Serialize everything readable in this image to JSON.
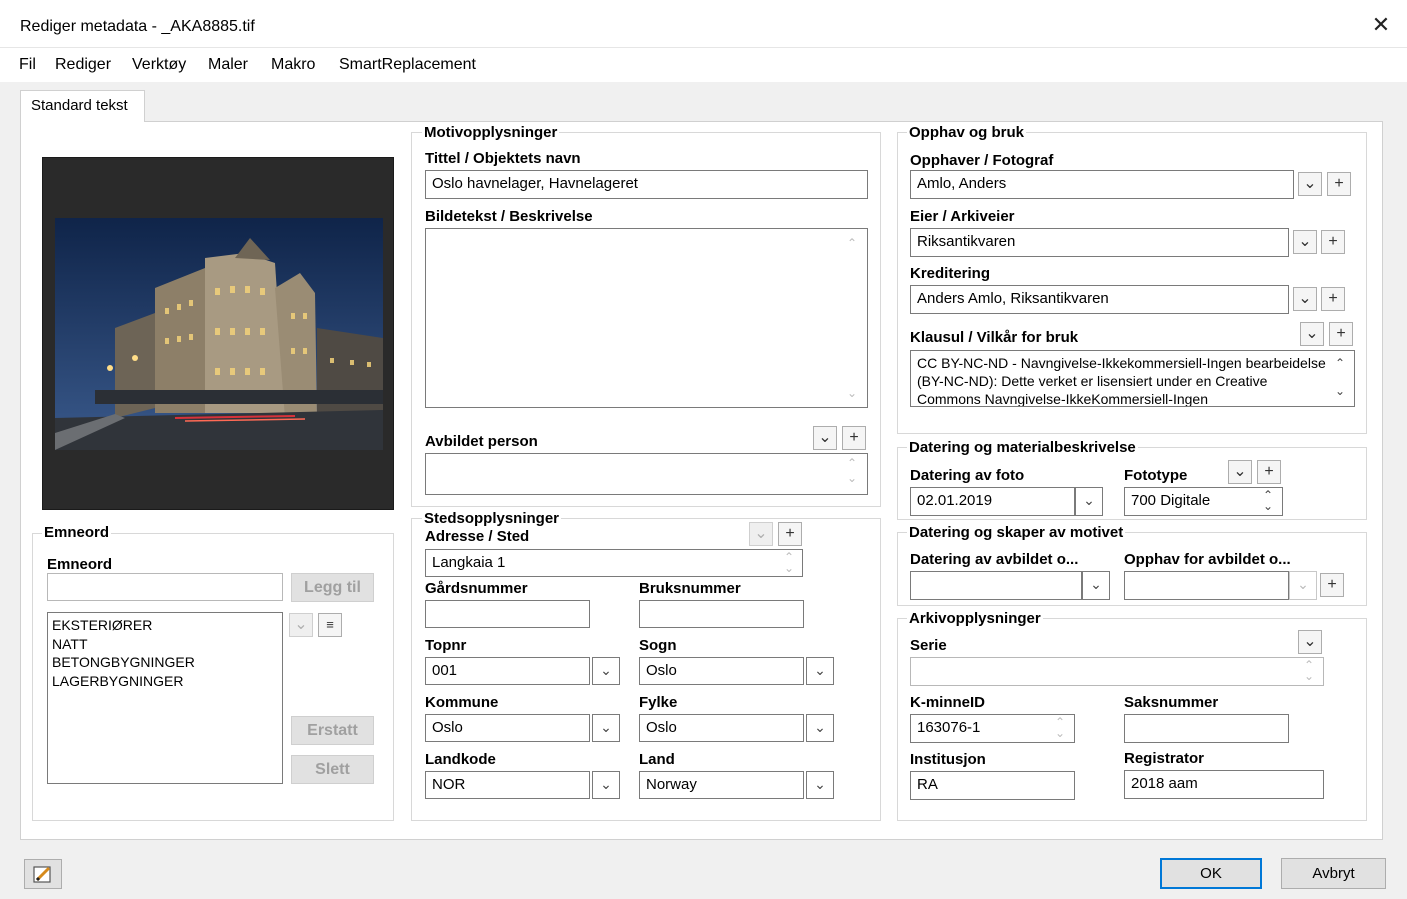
{
  "window": {
    "title": "Rediger metadata - _AKA8885.tif",
    "close": "✕"
  },
  "menu": [
    "Fil",
    "Rediger",
    "Verktøy",
    "Maler",
    "Makro",
    "SmartReplacement"
  ],
  "tab": "Standard tekst",
  "emneord": {
    "legend": "Emneord",
    "label": "Emneord",
    "input_value": "",
    "add_label": "Legg til",
    "items": [
      "EKSTERIØRER",
      "NATT",
      "BETONGBYGNINGER",
      "LAGERBYGNINGER"
    ],
    "replace_label": "Erstatt",
    "delete_label": "Slett"
  },
  "motiv": {
    "legend": "Motivopplysninger",
    "title_label": "Tittel / Objektets navn",
    "title_value": "Oslo havnelager, Havnelageret",
    "caption_label": "Bildetekst / Beskrivelse",
    "caption_value": "",
    "person_label": "Avbildet person",
    "person_value": ""
  },
  "sted": {
    "legend": "Stedsopplysninger",
    "address_label": "Adresse / Sted",
    "address_value": "Langkaia 1",
    "gardsnr_label": "Gårdsnummer",
    "gardsnr_value": "",
    "bruksnr_label": "Bruksnummer",
    "bruksnr_value": "",
    "topnr_label": "Topnr",
    "topnr_value": "001",
    "sogn_label": "Sogn",
    "sogn_value": "Oslo",
    "kommune_label": "Kommune",
    "kommune_value": "Oslo",
    "fylke_label": "Fylke",
    "fylke_value": "Oslo",
    "landkode_label": "Landkode",
    "landkode_value": "NOR",
    "land_label": "Land",
    "land_value": "Norway"
  },
  "opphav": {
    "legend": "Opphav og bruk",
    "photographer_label": "Opphaver / Fotograf",
    "photographer_value": "Amlo, Anders",
    "owner_label": "Eier / Arkiveier",
    "owner_value": "Riksantikvaren",
    "credit_label": "Kreditering",
    "credit_value": "Anders Amlo, Riksantikvaren",
    "clause_label": "Klausul / Vilkår for bruk",
    "clause_value": "CC BY-NC-ND - Navngivelse-Ikkekommersiell-Ingen bearbeidelse (BY-NC-ND): Dette verket er lisensiert under en Creative Commons Navngivelse-IkkeKommersiell-Ingen"
  },
  "datering": {
    "legend": "Datering og materialbeskrivelse",
    "date_label": "Datering av foto",
    "date_value": "02.01.2019",
    "type_label": "Fototype",
    "type_value": "700 Digitale"
  },
  "skaper": {
    "legend": "Datering og skaper av motivet",
    "date_label": "Datering av avbildet o...",
    "date_value": "",
    "creator_label": "Opphav for avbildet o...",
    "creator_value": ""
  },
  "arkiv": {
    "legend": "Arkivopplysninger",
    "serie_label": "Serie",
    "serie_value": "",
    "kminne_label": "K-minneID",
    "kminne_value": "163076-1",
    "saksnr_label": "Saksnummer",
    "saksnr_value": "",
    "inst_label": "Institusjon",
    "inst_value": "RA",
    "reg_label": "Registrator",
    "reg_value": "2018 aam"
  },
  "footer": {
    "ok_label": "OK",
    "cancel_label": "Avbryt"
  },
  "icons": {
    "dropdown": "chevron-down-icon",
    "add": "plus-icon",
    "spin": "spinner-icon",
    "sort": "sort-list-icon",
    "edit": "edit-pencil-icon"
  },
  "colors": {
    "accent": "#0078d7",
    "sky": "#1b3560",
    "building": "#a89a82"
  }
}
